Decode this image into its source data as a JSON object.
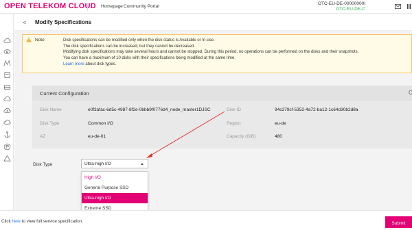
{
  "topbar": {
    "brand": "OPEN TELEKOM CLOUD",
    "nav": [
      "Homepage",
      "Community Portal"
    ],
    "account": "OTC-EU-DE-00000000I",
    "region": "OTC-EU-DE-C"
  },
  "header": {
    "back": "<",
    "title": "Modify Specifications"
  },
  "note": {
    "title": "Note",
    "lines": [
      "Disk specifications can be modified only when the disk status is Available or In-use.",
      "The disk specifications can be increased, but they cannot be decreased.",
      "Modifying disk specifications may take several hours and cannot be stopped. During this period, no operations can be performed on the disks and their snapshots.",
      "You can have a maximum of 10 disks with their specifications being modified at the same time."
    ],
    "learn_link": "Learn more",
    "learn_suffix": " about disk types."
  },
  "config": {
    "title": "Current Configuration",
    "corner": "C",
    "disk_name_label": "Disk Name",
    "disk_name": "e0f3afac-6d5c-4987-8f2e-0bbb9f0776d4_node_master1DJSC",
    "disk_id_label": "Disk ID",
    "disk_id": "94c379cf-5352-4a72-ba12-1c64d30b2d8a",
    "disk_type_label": "Disk Type",
    "disk_type": "Common I/O",
    "region_label": "Region",
    "region": "eu-de",
    "az_label": "AZ",
    "az": "eu-de-01",
    "capacity_label": "Capacity (GiB)",
    "capacity": "480"
  },
  "disk_type": {
    "label": "Disk Type",
    "selected": "Ultra-high I/O",
    "options": [
      "High I/O",
      "General Purpose SSD",
      "Ultra-high I/O",
      "Extreme SSD"
    ]
  },
  "footer": {
    "prefix": "Click ",
    "link": "here",
    "suffix": " to view full service specification.",
    "submit": "Submit"
  },
  "colors": {
    "brand": "#e20074",
    "link": "#1a6ce8",
    "region": "#2bb24c"
  }
}
